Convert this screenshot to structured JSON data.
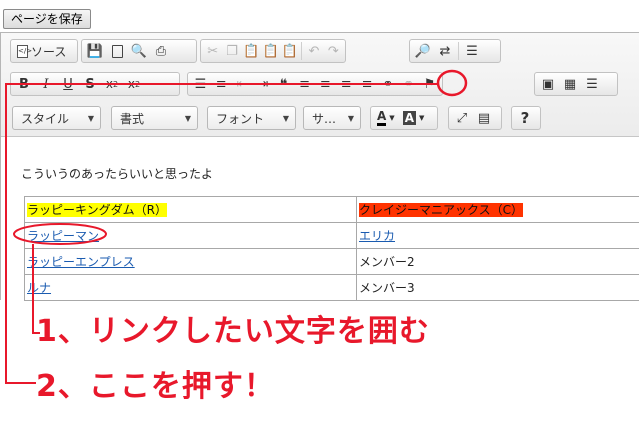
{
  "save_button": "ページを保存",
  "toolbar": {
    "source_label": "ソース",
    "format_combos": [
      "スタイル",
      "書式",
      "フォント",
      "サ…"
    ]
  },
  "content": {
    "intro": "こういうのあったらいいと思ったよ",
    "table": [
      [
        "ラッピーキングダム（R）",
        "クレイジーマニアックス（C）"
      ],
      [
        "ラッピーマン",
        "エリカ"
      ],
      [
        "ラッピーエンプレス",
        "メンバー2"
      ],
      [
        "ルナ",
        "メンバー3"
      ]
    ]
  },
  "annotations": {
    "step1": "1、リンクしたい文字を囲む",
    "step2": "2、ここを押す！"
  },
  "colors": {
    "annotation": "#e8182b",
    "highlight_yellow": "#ffff00",
    "highlight_red": "#ff3300",
    "link": "#1a5bb0"
  }
}
